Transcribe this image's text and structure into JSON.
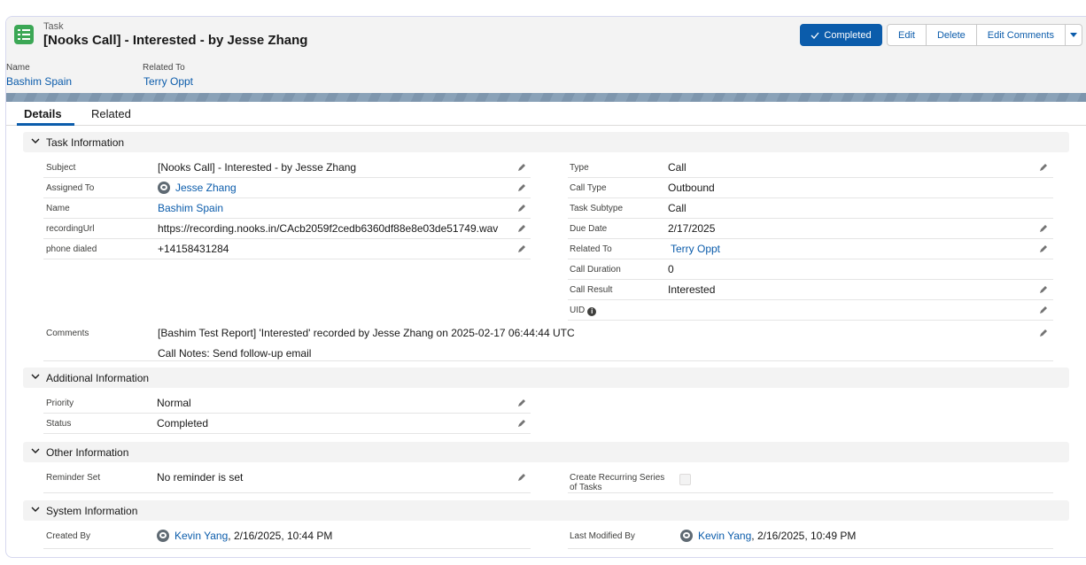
{
  "header": {
    "object_type": "Task",
    "title": "[Nooks Call] - Interested - by Jesse Zhang",
    "buttons": {
      "completed": "Completed",
      "edit": "Edit",
      "delete": "Delete",
      "edit_comments": "Edit Comments"
    },
    "highlights": {
      "name_label": "Name",
      "name_value": "Bashim Spain",
      "related_label": "Related To",
      "related_value": "Terry Oppt"
    }
  },
  "tabs": [
    "Details",
    "Related"
  ],
  "sections": {
    "task_information": "Task Information",
    "additional_information": "Additional Information",
    "other_information": "Other Information",
    "system_information": "System Information"
  },
  "task_info_left": [
    {
      "label": "Subject",
      "value": "[Nooks Call] - Interested - by Jesse Zhang"
    },
    {
      "label": "Assigned To",
      "value": "Jesse Zhang"
    },
    {
      "label": "Name",
      "value": "Bashim Spain"
    },
    {
      "label": "recordingUrl",
      "value": "https://recording.nooks.in/CAcb2059f2cedb6360df88e8e03de51749.wav"
    },
    {
      "label": "phone dialed",
      "value": "+14158431284"
    }
  ],
  "task_info_right": [
    {
      "label": "Type",
      "value": "Call"
    },
    {
      "label": "Call Type",
      "value": "Outbound"
    },
    {
      "label": "Task Subtype",
      "value": "Call"
    },
    {
      "label": "Due Date",
      "value": "2/17/2025"
    },
    {
      "label": "Related To",
      "value": "Terry Oppt"
    },
    {
      "label": "Call Duration",
      "value": "0"
    },
    {
      "label": "Call Result",
      "value": "Interested"
    },
    {
      "label": "UID",
      "value": ""
    }
  ],
  "comments": {
    "label": "Comments",
    "line1": "[Bashim Test Report] 'Interested' recorded by Jesse Zhang on 2025-02-17 06:44:44 UTC",
    "line2": "Call Notes: Send follow-up email"
  },
  "additional_info": [
    {
      "label": "Priority",
      "value": "Normal"
    },
    {
      "label": "Status",
      "value": "Completed"
    }
  ],
  "other_info": {
    "reminder_label": "Reminder Set",
    "reminder_value": "No reminder is set",
    "recurring_label_1": "Create Recurring Series",
    "recurring_label_2": "of Tasks",
    "recurring_checked": false
  },
  "system_info": {
    "created_label": "Created By",
    "created_user": "Kevin Yang",
    "created_date": ", 2/16/2025, 10:44 PM",
    "modified_label": "Last Modified By",
    "modified_user": "Kevin Yang",
    "modified_date": ", 2/16/2025, 10:49 PM"
  },
  "colors": {
    "brand_blue": "#0b5cab",
    "task_icon_green": "#3ba755",
    "section_bg": "#f3f3f3"
  },
  "icons": [
    "task-icon",
    "check-icon",
    "chevron-down-icon",
    "pencil-icon",
    "avatar-icon",
    "info-icon",
    "dropdown-icon"
  ]
}
